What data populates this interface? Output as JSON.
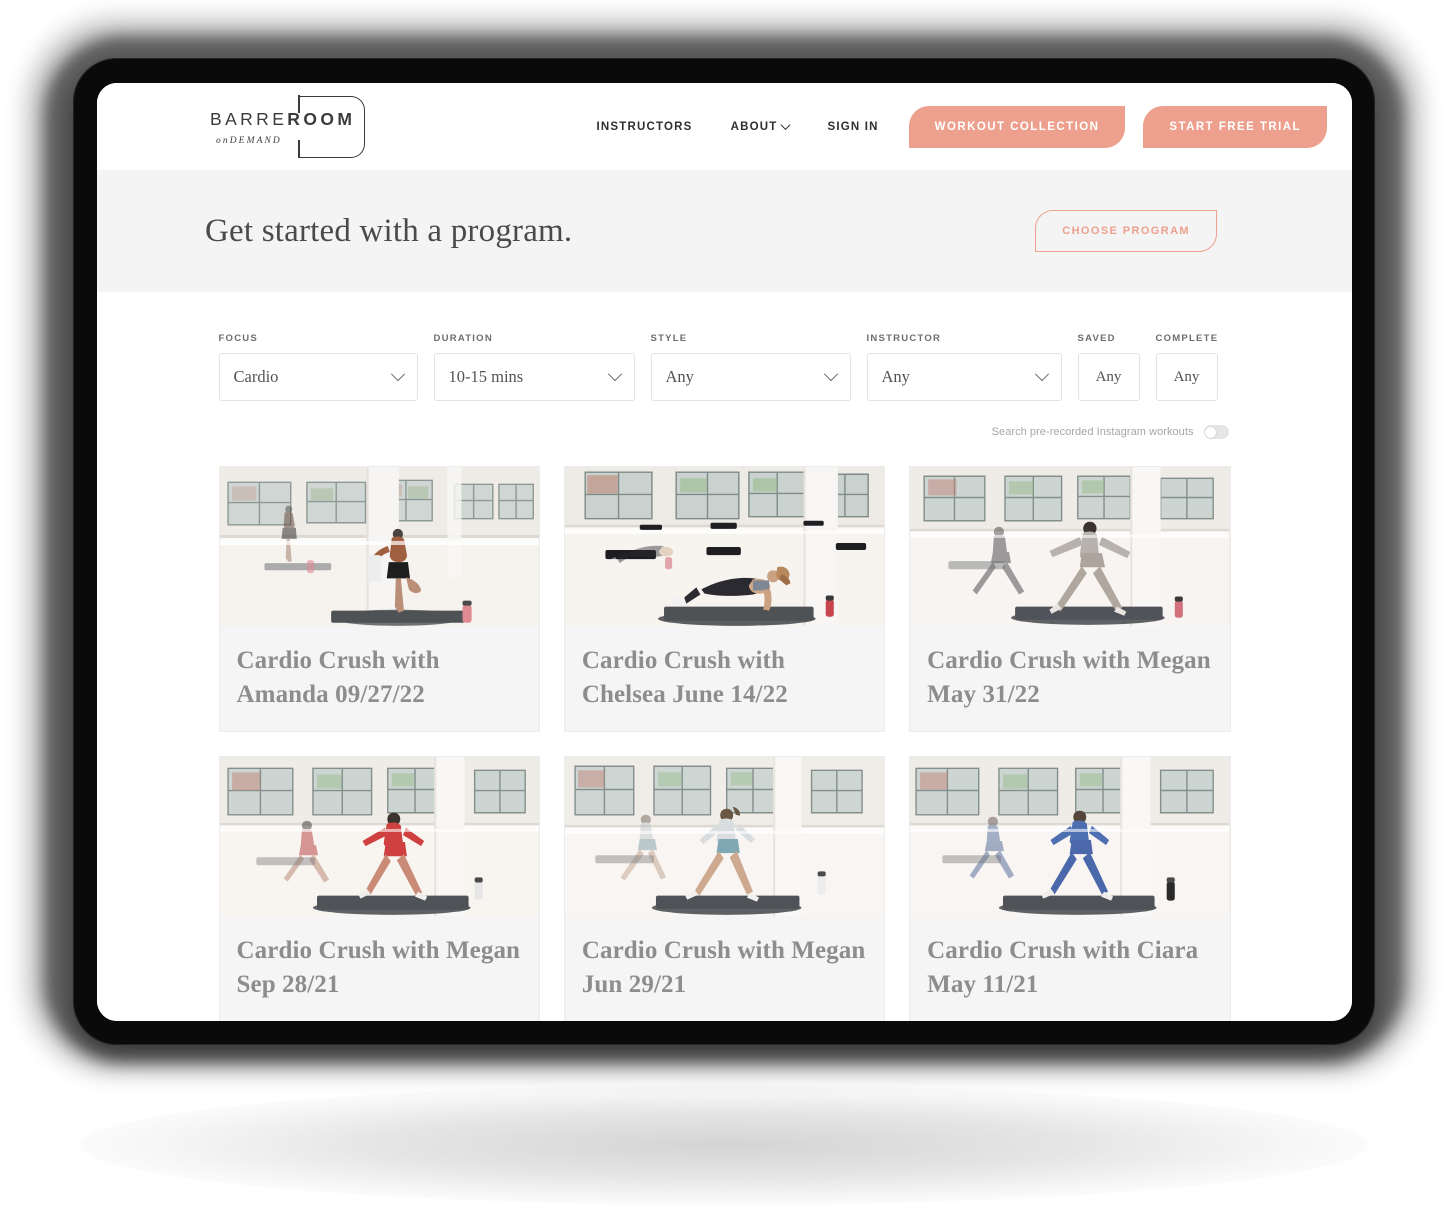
{
  "brand": {
    "logo_main_light": "BARRE",
    "logo_main_bold": "ROOM",
    "logo_sub": "onDEMAND",
    "accent_color": "#eda08d",
    "hero_band_color": "#f4f4f4",
    "card_bg_color": "#f5f5f5",
    "title_text_color": "#8d8d8d"
  },
  "header": {
    "nav": [
      {
        "label": "INSTRUCTORS",
        "has_caret": false
      },
      {
        "label": "ABOUT",
        "has_caret": true
      },
      {
        "label": "SIGN IN",
        "has_caret": false
      }
    ],
    "primary_button": "WORKOUT COLLECTION",
    "secondary_button": "START FREE TRIAL"
  },
  "hero": {
    "title": "Get started with a program.",
    "cta": "CHOOSE PROGRAM"
  },
  "filters": [
    {
      "label": "FOCUS",
      "value": "Cardio",
      "type": "select"
    },
    {
      "label": "DURATION",
      "value": "10-15 mins",
      "type": "select"
    },
    {
      "label": "STYLE",
      "value": "Any",
      "type": "select"
    },
    {
      "label": "INSTRUCTOR",
      "value": "Any",
      "type": "select"
    },
    {
      "label": "SAVED",
      "value": "Any",
      "type": "box"
    },
    {
      "label": "COMPLETE",
      "value": "Any",
      "type": "box"
    }
  ],
  "toggle": {
    "label": "Search pre-recorded Instagram workouts",
    "state": "off"
  },
  "cards": [
    {
      "title": "Cardio Crush with Amanda 09/27/22",
      "image_alt": "woman balancing on one leg on mat in bright barre studio"
    },
    {
      "title": "Cardio Crush with Chelsea June 14/22",
      "image_alt": "woman in plank position on mat in barre studio"
    },
    {
      "title": "Cardio Crush with Megan May 31/22",
      "image_alt": "woman in wide stance lunge in barre studio"
    },
    {
      "title": "Cardio Crush with Megan Sep 28/21",
      "image_alt": "woman in red activewear lunging on mat"
    },
    {
      "title": "Cardio Crush with Megan Jun 29/21",
      "image_alt": "woman mid-stride running on mat in studio"
    },
    {
      "title": "Cardio Crush with Ciara May 11/21",
      "image_alt": "woman in blue activewear lunging on mat"
    }
  ]
}
